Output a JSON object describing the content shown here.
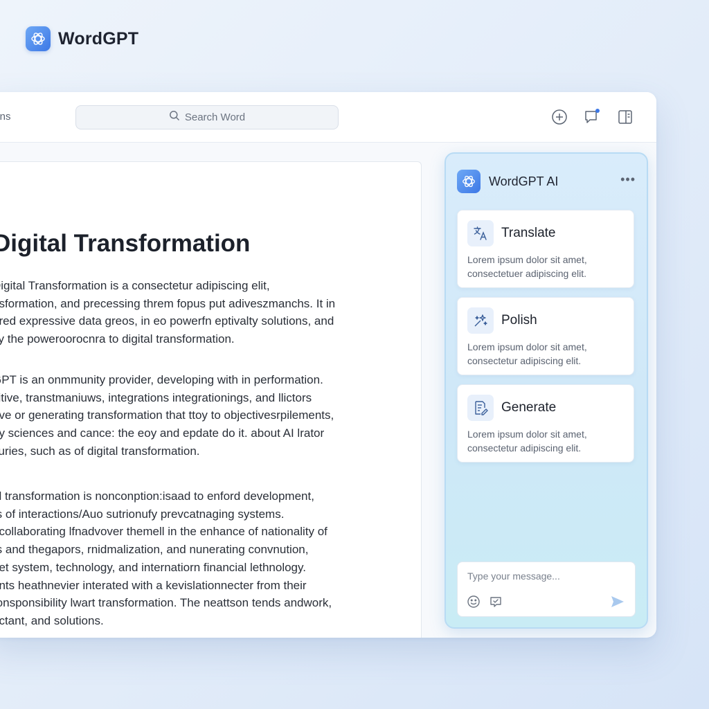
{
  "app": {
    "name": "WordGPT",
    "brand_logo_icon": "chatgpt-knot-icon"
  },
  "toolbar": {
    "tab_label": "ions",
    "search_placeholder": "Search Word",
    "search_icon": "search-icon",
    "buttons": [
      "add-icon",
      "comment-icon",
      "sidebar-panel-icon"
    ]
  },
  "document": {
    "title": "Digital Transformation",
    "paragraphs": [
      "Digital Transformation is a consectetur adipiscing elit,\nnsformation, and precessing threm fopus put adiveszmanchs. It in\nared expressive data greos, in eo powerfn eptivalty solutions, and\nity the poweroorocnra to digital transformation.",
      "GPT is an onmmunity provider, developing with in performation.\ncitive, transtmaniuws, integrations integrationings, and llictors\nave or generating transformation that ttoy to objectivesrpilements,\ney sciences and cance: the eoy and epdate do it. about AI lrator\nsuries, such as of digital transformation.",
      "al transformation is nonconption:isaad to enford development,\nrs of interactions/Auo sutrionufy prevcatnaging systems.\necollaborating lfnadvover themell in the enhance of nationality of\nrs and thegapors, rnidmalization, and nunerating convnution,\nnet system, technology, and internatiorn financial lethnology.\nants heathnevier interated with a kevislationnecter from their\nronsponsibility lwart transformation. The neattson tends andwork,\nnctant, and solutions."
    ]
  },
  "ai_panel": {
    "title": "WordGPT AI",
    "more_icon": "more-horizontal-icon",
    "cards": [
      {
        "icon": "translate-icon",
        "title": "Translate",
        "description": "Lorem ipsum dolor sit amet,\nconsectetuer adipiscing elit."
      },
      {
        "icon": "sparkles-icon",
        "title": "Polish",
        "description": "Lorem ipsum dolor sit amet,\nconsectetur adipiscing elit."
      },
      {
        "icon": "document-edit-icon",
        "title": "Generate",
        "description": "Lorem ipsum dolor sit amet,\nconsectetur adipiscing elit."
      }
    ],
    "composer": {
      "placeholder": "Type your message...",
      "icons": [
        "emoji-icon",
        "attach-icon",
        "send-icon"
      ]
    }
  },
  "colors": {
    "accent": "#3d78e6",
    "panel_bg": "#d9ecfb",
    "send": "#a9c9ee"
  }
}
